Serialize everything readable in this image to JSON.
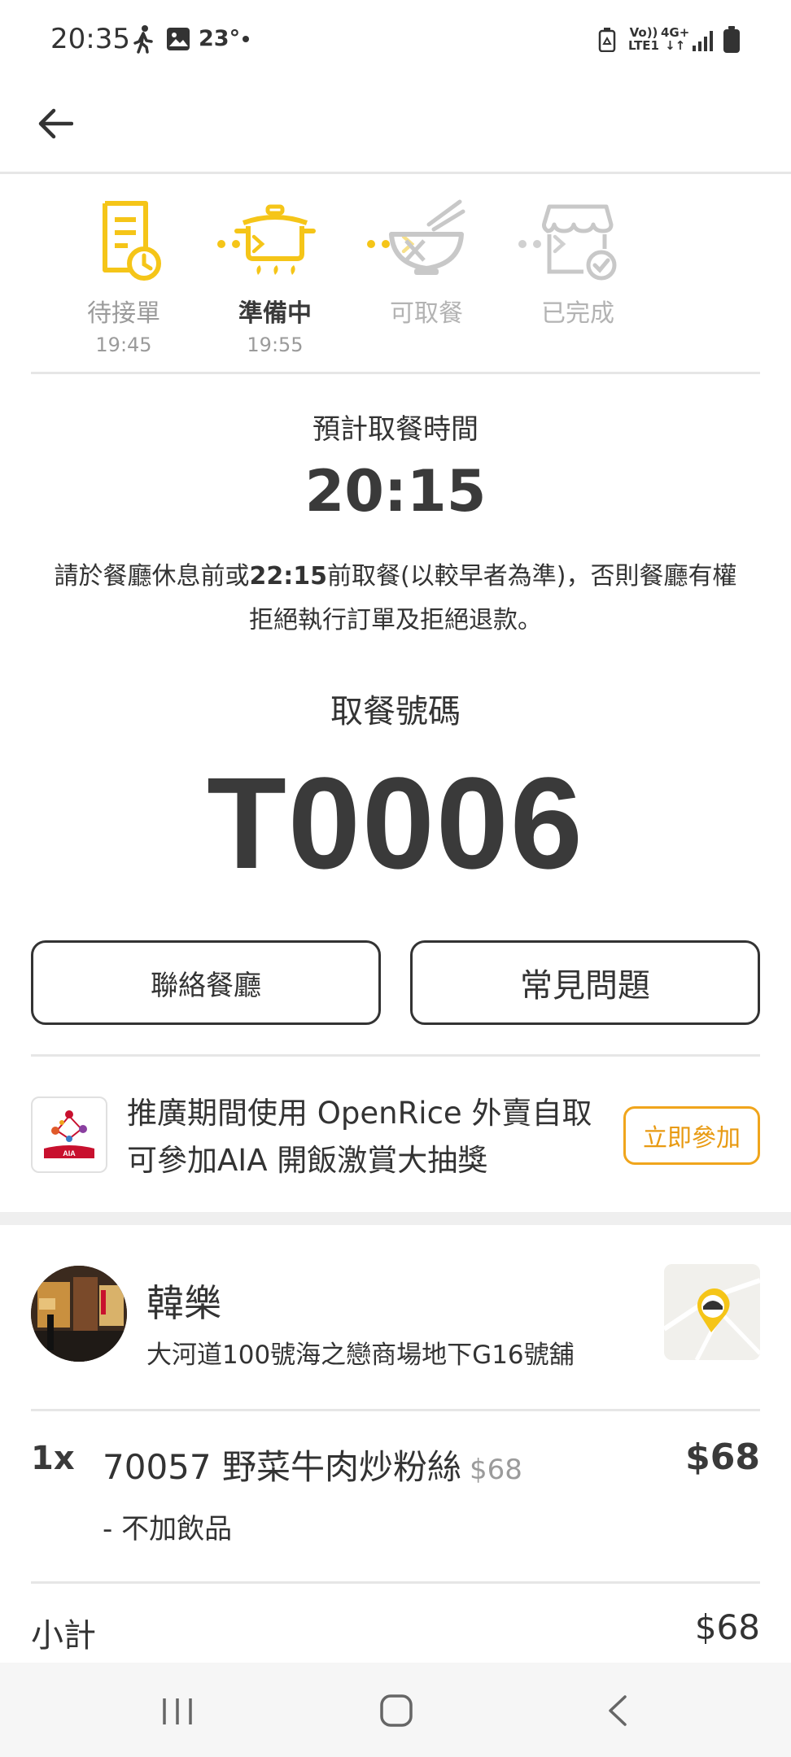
{
  "status_bar": {
    "time": "20:35",
    "temperature": "23°",
    "volte_line1": "Vo))",
    "volte_line2": "LTE1",
    "network": "4G+"
  },
  "header": {
    "back_icon": "arrow-left-icon"
  },
  "steps": [
    {
      "label": "待接單",
      "time": "19:45",
      "state": "done",
      "icon": "order-receipt-clock-icon"
    },
    {
      "label": "準備中",
      "time": "19:55",
      "state": "active",
      "icon": "cooking-pot-icon"
    },
    {
      "label": "可取餐",
      "time": "",
      "state": "pending",
      "icon": "noodle-bowl-icon"
    },
    {
      "label": "已完成",
      "time": "",
      "state": "pending",
      "icon": "store-check-icon"
    }
  ],
  "pickup": {
    "title": "預計取餐時間",
    "time": "20:15",
    "notice_before": "請於餐廳休息前或",
    "notice_time": "22:15",
    "notice_after": "前取餐(以較早者為準)，否則餐廳有權拒絕執行訂單及拒絕退款。"
  },
  "pickup_code": {
    "title": "取餐號碼",
    "value": "T0006"
  },
  "buttons": {
    "contact": "聯絡餐廳",
    "faq": "常見問題"
  },
  "promo": {
    "logo_text": "AIA",
    "text": "推廣期間使用 OpenRice 外賣自取可參加AIA 開飯激賞大抽獎",
    "button": "立即參加"
  },
  "restaurant": {
    "name": "韓樂",
    "address": "大河道100號海之戀商場地下G16號舖"
  },
  "order": {
    "items": [
      {
        "qty": "1x",
        "name": "70057 野菜牛肉炒粉絲",
        "unit_price": "$68",
        "price": "$68",
        "option": "- 不加飲品"
      }
    ],
    "subtotal_label": "小計",
    "subtotal_value": "$68"
  },
  "colors": {
    "accent_yellow": "#f5c518",
    "promo_orange": "#f0a51c",
    "inactive_grey": "#c8c8c8"
  }
}
